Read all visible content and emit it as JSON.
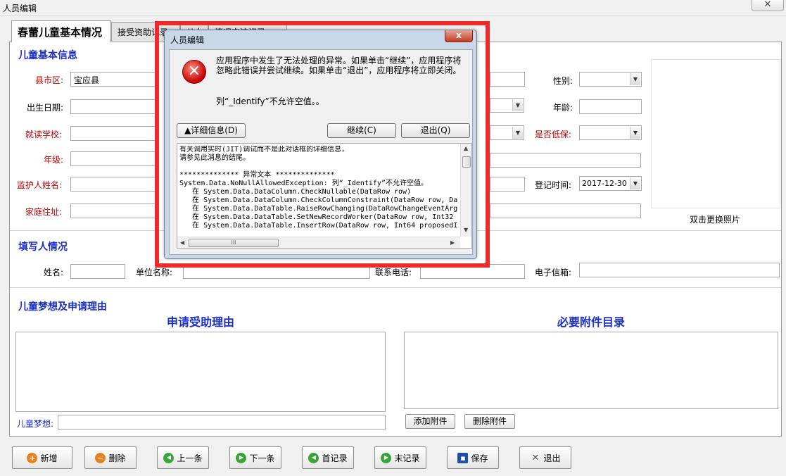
{
  "window": {
    "title": "人员编辑",
    "close": "✕"
  },
  "tabs": [
    "春蕾儿童基本情况",
    "接受资助记录",
    "儿女",
    "情况交流记录"
  ],
  "basic": {
    "section_title": "儿童基本信息",
    "county_label": "县市区:",
    "county_value": "宝应县",
    "birth_label": "出生日期:",
    "school_label": "就读学校:",
    "grade_label": "年级:",
    "guardian_label": "监护人姓名:",
    "address_label": "家庭住址:",
    "gender_label": "性别:",
    "age_label": "年龄:",
    "low_income_label": "是否低保:",
    "reg_time_label": "登记时间:",
    "reg_time_value": "2017-12-30",
    "photo_caption": "双击更换照片"
  },
  "filler": {
    "section_title": "填写人情况",
    "name_label": "姓名:",
    "org_label": "单位名称:",
    "phone_label": "联系电话:",
    "email_label": "电子信箱:"
  },
  "dream": {
    "section_title": "儿童梦想及申请理由",
    "reason_title": "申请受助理由",
    "attachments_title": "必要附件目录",
    "dream_label": "儿童梦想:",
    "add_attachment": "添加附件",
    "delete_attachment": "删除附件"
  },
  "toolbar": [
    {
      "label": "新增",
      "icon": "plus-icon",
      "color": "#e8821e",
      "glyph": "+"
    },
    {
      "label": "删除",
      "icon": "minus-icon",
      "color": "#e8821e",
      "glyph": "−"
    },
    {
      "label": "上一条",
      "icon": "arrow-left-icon",
      "color": "#3aa53a",
      "glyph": "◀"
    },
    {
      "label": "下一条",
      "icon": "arrow-right-icon",
      "color": "#3aa53a",
      "glyph": "▶"
    },
    {
      "label": "首记录",
      "icon": "first-record-icon",
      "color": "#3aa53a",
      "glyph": "◀"
    },
    {
      "label": "末记录",
      "icon": "last-record-icon",
      "color": "#3aa53a",
      "glyph": "▶"
    },
    {
      "label": "保存",
      "icon": "save-icon",
      "color": "#1f4fa8",
      "glyph": "▪"
    },
    {
      "label": "退出",
      "icon": "close-icon",
      "color": "#555555",
      "glyph": "✕"
    }
  ],
  "dialog": {
    "title": "人员编辑",
    "close": "x",
    "message": "应用程序中发生了无法处理的异常。如果单击“继续”，应用程序将忽略此错误并尝试继续。如果单击“退出”，应用程序将立即关闭。",
    "column_message": "列“_Identify”不允许空值。。",
    "details_button": "▲详细信息(D)",
    "continue_button": "继续(C)",
    "quit_button": "退出(Q)",
    "details": "有关调用实时(JIT)调试而不是此对话框的详细信息，\n请参见此消息的结尾。\n\n************** 异常文本 **************\nSystem.Data.NoNullAllowedException: 列“_Identify”不允许空值。\n   在 System.Data.DataColumn.CheckNullable(DataRow row)\n   在 System.Data.DataColumn.CheckColumnConstraint(DataRow row, Da\n   在 System.Data.DataTable.RaiseRowChanging(DataRowChangeEventArg\n   在 System.Data.DataTable.SetNewRecordWorker(DataRow row, Int32\n   在 System.Data.DataTable.InsertRow(DataRow row, Int64 proposedI"
  }
}
